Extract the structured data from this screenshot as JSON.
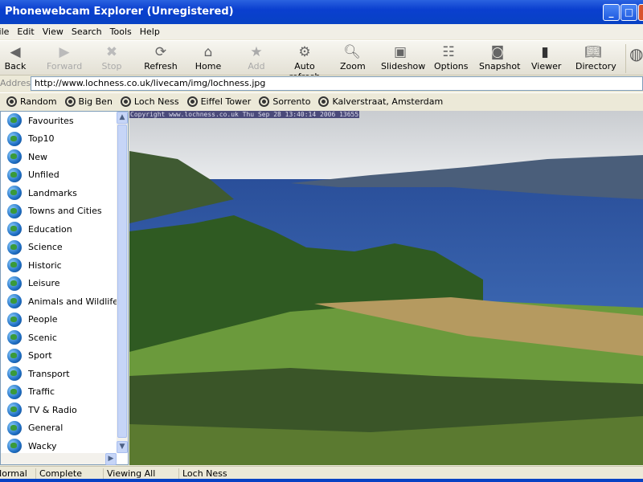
{
  "window": {
    "title": "Phonewebcam Explorer (Unregistered)"
  },
  "menu": [
    "File",
    "Edit",
    "View",
    "Search",
    "Tools",
    "Help"
  ],
  "toolbar": [
    {
      "label": "Back",
      "icon": "back-arrow",
      "enabled": true
    },
    {
      "label": "Forward",
      "icon": "forward-arrow",
      "enabled": false
    },
    {
      "label": "Stop",
      "icon": "stop-x",
      "enabled": false
    },
    {
      "label": "Refresh",
      "icon": "refresh",
      "enabled": true
    },
    {
      "label": "Home",
      "icon": "home",
      "enabled": true
    },
    {
      "label": "Add",
      "icon": "star",
      "enabled": false
    },
    {
      "label": "Auto refresh",
      "icon": "gear",
      "enabled": true
    },
    {
      "label": "Zoom",
      "icon": "magnifier",
      "enabled": true
    },
    {
      "label": "Slideshow",
      "icon": "slideshow",
      "enabled": true
    },
    {
      "label": "Options",
      "icon": "options",
      "enabled": true
    },
    {
      "label": "Snapshot",
      "icon": "camera",
      "enabled": true
    },
    {
      "label": "Viewer",
      "icon": "phone",
      "enabled": true
    },
    {
      "label": "Directory",
      "icon": "book",
      "enabled": true
    }
  ],
  "address": {
    "label": "Address",
    "value": "http://www.lochness.co.uk/livecam/img/lochness.jpg"
  },
  "links": [
    "Random",
    "Big Ben",
    "Loch Ness",
    "Eiffel Tower",
    "Sorrento",
    "Kalverstraat, Amsterdam"
  ],
  "sidebar": [
    "Favourites",
    "Top10",
    "New",
    "Unfiled",
    "Landmarks",
    "Towns and Cities",
    "Education",
    "Science",
    "Historic",
    "Leisure",
    "Animals and Wildlife",
    "People",
    "Scenic",
    "Sport",
    "Transport",
    "Traffic",
    "TV & Radio",
    "General",
    "Wacky"
  ],
  "image": {
    "stamp": "Copyright www.lochness.co.uk Thu Sep 28 13:40:14 2006 13655"
  },
  "status": [
    "Normal",
    "Complete",
    "Viewing All",
    "Loch Ness"
  ]
}
